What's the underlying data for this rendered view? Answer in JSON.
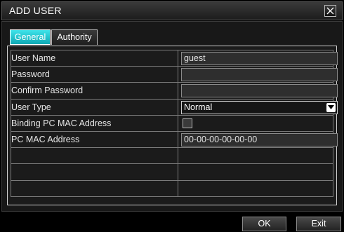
{
  "dialog": {
    "title": "ADD USER",
    "close_icon": "close-icon"
  },
  "tabs": [
    {
      "label": "General",
      "active": true
    },
    {
      "label": "Authority",
      "active": false
    }
  ],
  "form": {
    "user_name": {
      "label": "User Name",
      "value": "guest"
    },
    "password": {
      "label": "Password",
      "value": ""
    },
    "confirm_password": {
      "label": "Confirm Password",
      "value": ""
    },
    "user_type": {
      "label": "User Type",
      "value": "Normal"
    },
    "binding_mac": {
      "label": "Binding PC MAC Address",
      "checked": false
    },
    "pc_mac": {
      "label": "PC MAC Address",
      "value": "00-00-00-00-00-00"
    }
  },
  "buttons": {
    "ok": "OK",
    "exit": "Exit"
  },
  "colors": {
    "active_tab": "#1fc8d2",
    "background": "#000000"
  }
}
